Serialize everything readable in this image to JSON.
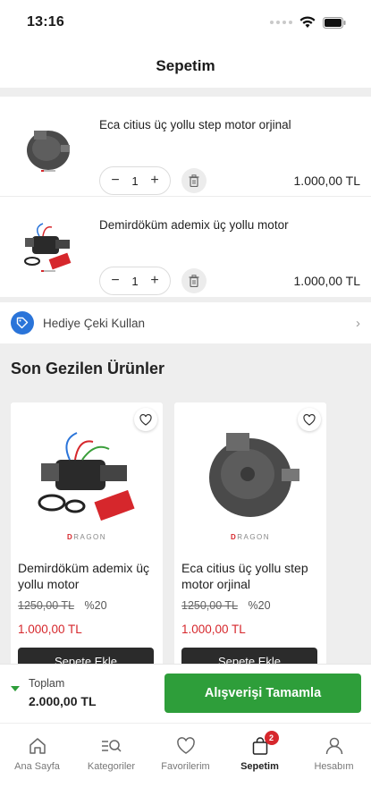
{
  "status_bar": {
    "time": "13:16"
  },
  "header": {
    "title": "Sepetim"
  },
  "cart": {
    "items": [
      {
        "name": "Eca citius üç yollu step motor orjinal",
        "quantity": "1",
        "price": "1.000,00 TL"
      },
      {
        "name": "Demirdöküm ademix üç yollu motor",
        "quantity": "1",
        "price": "1.000,00 TL"
      }
    ]
  },
  "gift": {
    "label": "Hediye Çeki Kullan"
  },
  "recent": {
    "title": "Son Gezilen Ürünler",
    "items": [
      {
        "brand_prefix": "D",
        "brand_rest": "RAGON",
        "name": "Demirdöküm ademix üç yollu motor",
        "old_price": "1250,00 TL",
        "discount": "%20",
        "price": "1.000,00 TL",
        "button": "Sepete Ekle"
      },
      {
        "brand_prefix": "D",
        "brand_rest": "RAGON",
        "name": "Eca citius üç yollu step motor orjinal",
        "old_price": "1250,00 TL",
        "discount": "%20",
        "price": "1.000,00 TL",
        "button": "Sepete Ekle"
      }
    ]
  },
  "summary": {
    "total_label": "Toplam",
    "total_value": "2.000,00 TL",
    "checkout_label": "Alışverişi Tamamla"
  },
  "tabbar": {
    "tabs": [
      {
        "label": "Ana Sayfa",
        "icon": "home-icon"
      },
      {
        "label": "Kategoriler",
        "icon": "categories-icon"
      },
      {
        "label": "Favorilerim",
        "icon": "heart-icon"
      },
      {
        "label": "Sepetim",
        "icon": "bag-icon",
        "badge": "2",
        "active": true
      },
      {
        "label": "Hesabım",
        "icon": "user-icon"
      }
    ]
  },
  "colors": {
    "accent_green": "#2e9e3a",
    "price_red": "#d6272c",
    "gift_blue": "#2a74d9"
  }
}
